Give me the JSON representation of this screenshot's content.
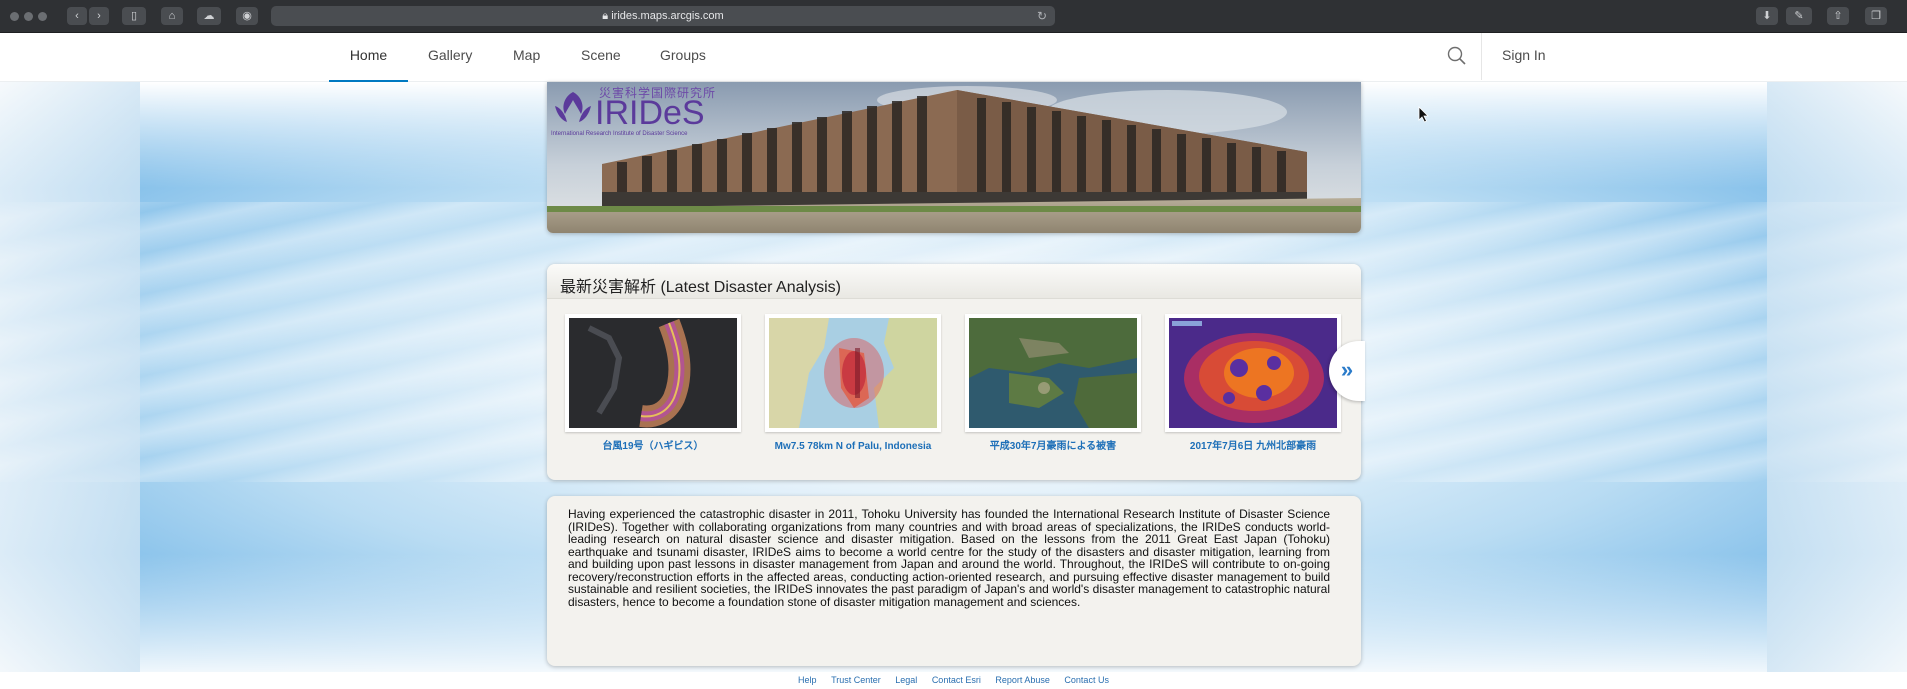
{
  "browser": {
    "url": "irides.maps.arcgis.com"
  },
  "nav": {
    "tabs": [
      {
        "label": "Home"
      },
      {
        "label": "Gallery"
      },
      {
        "label": "Map"
      },
      {
        "label": "Scene"
      },
      {
        "label": "Groups"
      }
    ],
    "active_tab": "Home",
    "sign_in": "Sign In"
  },
  "banner": {
    "japanese_name": "災害科学国際研究所",
    "logo_text": "IRIDeS",
    "subtitle": "International Research Institute of Disaster Science"
  },
  "latest": {
    "title": "最新災害解析 (Latest Disaster Analysis)",
    "items": [
      {
        "caption": "台風19号（ハギビス）",
        "icon": "typhoon-track-map"
      },
      {
        "caption": "Mw7.5 78km N of Palu, Indonesia",
        "icon": "earthquake-map"
      },
      {
        "caption": "平成30年7月豪雨による被害",
        "icon": "satellite-image"
      },
      {
        "caption": "2017年7月6日 九州北部豪雨",
        "icon": "heatmap"
      }
    ],
    "next_icon": "double-chevron-right-icon"
  },
  "description": "Having experienced the catastrophic disaster in 2011, Tohoku University has founded the International Research Institute of Disaster Science (IRIDeS). Together with collaborating organizations from many countries and with broad areas of specializations, the IRIDeS conducts world-leading research on natural disaster science and disaster mitigation. Based on the lessons from the 2011 Great East Japan (Tohoku) earthquake and tsunami disaster, IRIDeS aims to become a world centre for the study of the disasters and disaster mitigation, learning from and building upon past lessons in disaster management from Japan and around the world. Throughout, the IRIDeS will contribute to on-going recovery/reconstruction efforts in the affected areas, conducting action-oriented research, and pursuing effective disaster management to build sustainable and resilient societies, the IRIDeS innovates the past paradigm of Japan's and world's disaster management to catastrophic natural disasters, hence to become a foundation stone of disaster mitigation management and sciences.",
  "footer": {
    "links": [
      "Help",
      "Trust Center",
      "Legal",
      "Contact Esri",
      "Report Abuse",
      "Contact Us"
    ]
  },
  "colors": {
    "accent": "#0079c1",
    "link": "#1d6fb8"
  }
}
